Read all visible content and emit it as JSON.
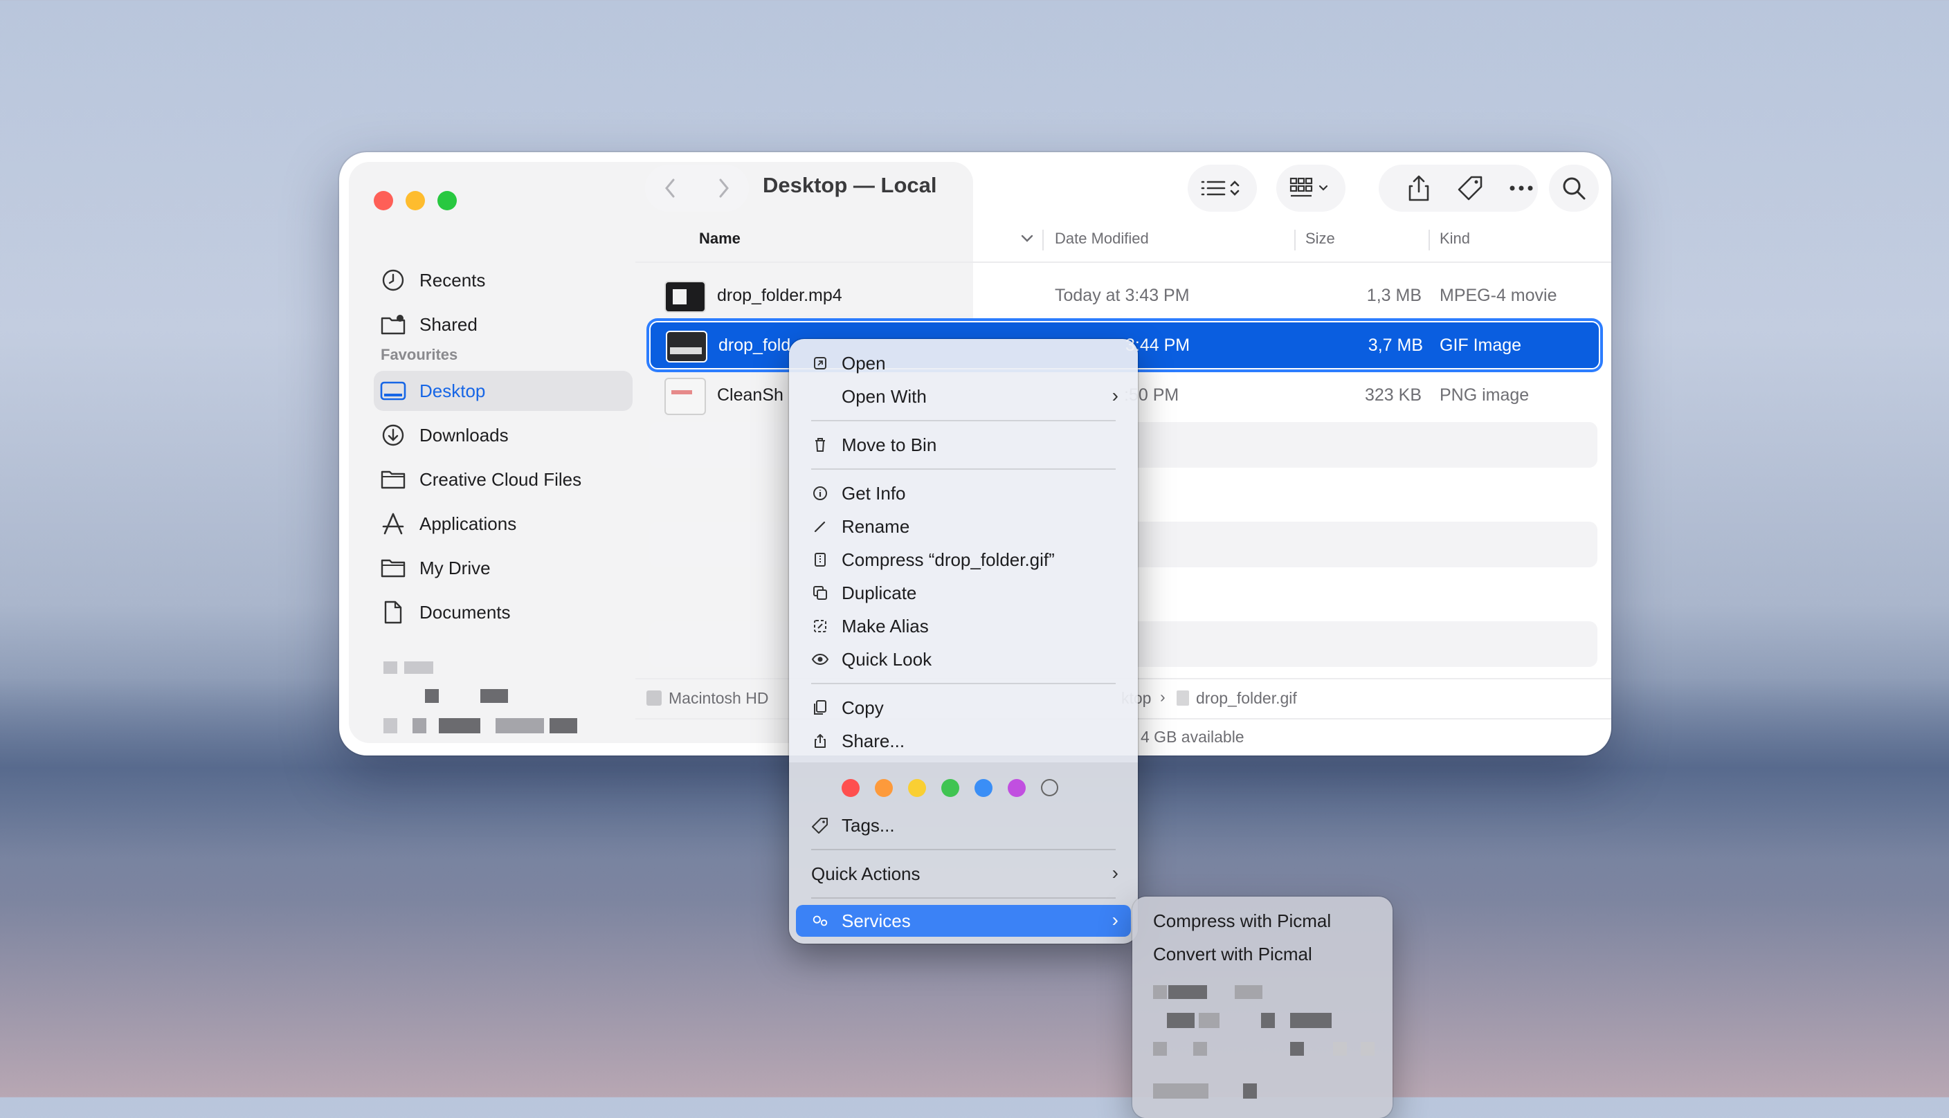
{
  "window": {
    "title": "Desktop — Local"
  },
  "sidebar": {
    "top_items": [
      {
        "label": "Recents",
        "icon": "clock-icon"
      },
      {
        "label": "Shared",
        "icon": "shared-folder-icon"
      }
    ],
    "section_header": "Favourites",
    "favourites": [
      {
        "label": "Desktop",
        "icon": "desktop-icon",
        "active": true
      },
      {
        "label": "Downloads",
        "icon": "download-icon"
      },
      {
        "label": "Creative Cloud Files",
        "icon": "folder-icon"
      },
      {
        "label": "Applications",
        "icon": "applications-icon"
      },
      {
        "label": "My Drive",
        "icon": "folder-icon"
      },
      {
        "label": "Documents",
        "icon": "document-icon"
      }
    ]
  },
  "columns": {
    "name": "Name",
    "date": "Date Modified",
    "size": "Size",
    "kind": "Kind"
  },
  "files": [
    {
      "name": "drop_folder.mp4",
      "date": "Today at 3:43 PM",
      "size": "1,3 MB",
      "kind": "MPEG-4 movie"
    },
    {
      "name": "drop_fold",
      "date": "3:44 PM",
      "size": "3,7 MB",
      "kind": "GIF Image",
      "selected": true
    },
    {
      "name": "CleanSh",
      "date": ":50 PM",
      "size": "323 KB",
      "kind": "PNG image"
    }
  ],
  "path_bar": {
    "root": "Macintosh HD",
    "desktop": "ktop",
    "file": "drop_folder.gif"
  },
  "status_bar": {
    "available": "4 GB available"
  },
  "context_menu": {
    "open": "Open",
    "open_with": "Open With",
    "move_to_bin": "Move to Bin",
    "get_info": "Get Info",
    "rename": "Rename",
    "compress": "Compress “drop_folder.gif”",
    "duplicate": "Duplicate",
    "make_alias": "Make Alias",
    "quick_look": "Quick Look",
    "copy": "Copy",
    "share": "Share...",
    "tags": "Tags...",
    "quick_actions": "Quick Actions",
    "services": "Services",
    "tag_colors": [
      "#fe4f4f",
      "#fd9a3b",
      "#f9cf33",
      "#40c452",
      "#3a8ef6",
      "#c14fe0",
      "none"
    ]
  },
  "services_submenu": {
    "items": [
      "Compress with Picmal",
      "Convert with Picmal"
    ]
  }
}
